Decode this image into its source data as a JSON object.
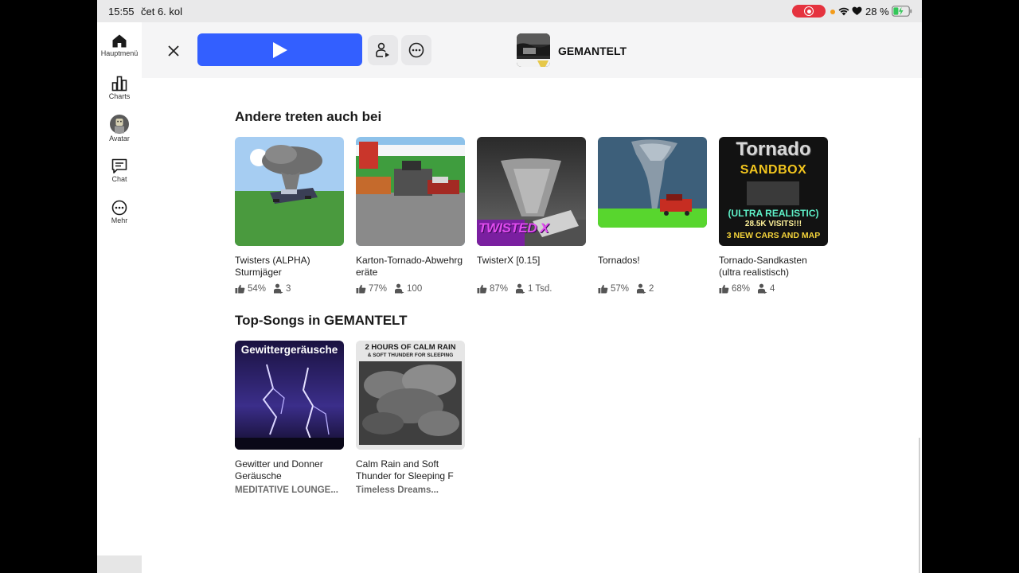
{
  "status_bar": {
    "time": "15:55",
    "date": "čet 6. kol",
    "battery": "28 %"
  },
  "nav": {
    "items": [
      {
        "label": "Hauptmenü",
        "icon": "home-icon"
      },
      {
        "label": "Charts",
        "icon": "charts-icon"
      },
      {
        "label": "Avatar",
        "icon": "avatar-icon"
      },
      {
        "label": "Chat",
        "icon": "chat-icon"
      },
      {
        "label": "Mehr",
        "icon": "more-icon"
      }
    ]
  },
  "header": {
    "title": "GEMANTELT"
  },
  "others_section": {
    "title": "Andere treten auch bei",
    "games": [
      {
        "name": "Twisters (ALPHA) Sturmjäger",
        "rating": "54%",
        "players": "3"
      },
      {
        "name": "Karton-Tornado-Abwehrgeräte",
        "rating": "77%",
        "players": "100"
      },
      {
        "name": "TwisterX [0.15]",
        "rating": "87%",
        "players": "1 Tsd.",
        "thumb_text": "TWISTED X"
      },
      {
        "name": "Tornados!",
        "rating": "57%",
        "players": "2"
      },
      {
        "name": "Tornado-Sandkasten (ultra realistisch)",
        "rating": "68%",
        "players": "4",
        "thumb_text": {
          "l1": "Tornado",
          "l2": "SANDBOX",
          "l3": "(ULTRA REALISTIC)",
          "l4": "28.5K VISITS!!!",
          "l5": "3 NEW CARS AND MAP"
        }
      }
    ]
  },
  "songs_section": {
    "title": "Top-Songs in GEMANTELT",
    "songs": [
      {
        "name": "Gewitter und Donner Geräusche",
        "artist": "MEDITATIVE LOUNGE...",
        "thumb_text": "Gewittergeräusche"
      },
      {
        "name": "Calm Rain and Soft Thunder for Sleeping F",
        "artist": "Timeless Dreams...",
        "thumb_text": {
          "l1": "2 HOURS OF CALM RAIN",
          "l2": "& SOFT THUNDER FOR SLEEPING"
        }
      }
    ]
  },
  "colors": {
    "play": "#335fff",
    "record": "#e5333f",
    "battery": "#34c759"
  }
}
